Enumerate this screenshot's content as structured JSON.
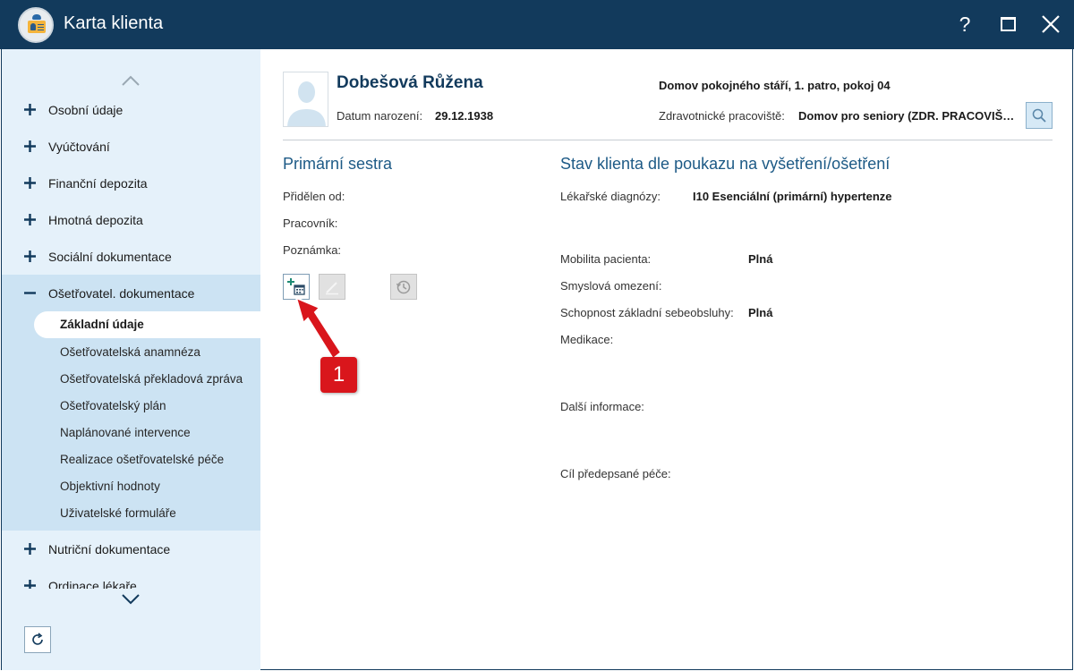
{
  "window": {
    "title": "Karta klienta",
    "help_label": "?",
    "icons": {
      "app": "client-card-icon",
      "maximize": "maximize-icon",
      "close": "close-icon"
    }
  },
  "sidebar": {
    "items_top": [
      {
        "label": "Osobní údaje",
        "expanded": false
      },
      {
        "label": "Vyúčtování",
        "expanded": false
      },
      {
        "label": "Finanční depozita",
        "expanded": false
      },
      {
        "label": "Hmotná depozita",
        "expanded": false
      },
      {
        "label": "Sociální dokumentace",
        "expanded": false
      },
      {
        "label": "Ošetřovatel. dokumentace",
        "expanded": true
      }
    ],
    "sub_items": [
      {
        "label": "Základní údaje",
        "active": true
      },
      {
        "label": "Ošetřovatelská anamnéza"
      },
      {
        "label": "Ošetřovatelská překladová zpráva"
      },
      {
        "label": "Ošetřovatelský plán"
      },
      {
        "label": "Naplánované intervence"
      },
      {
        "label": "Realizace ošetřovatelské péče"
      },
      {
        "label": "Objektivní hodnoty"
      },
      {
        "label": "Uživatelské formuláře"
      }
    ],
    "items_bottom": [
      {
        "label": "Nutriční dokumentace",
        "expanded": false
      },
      {
        "label": "Ordinace lékaře",
        "expanded": false
      }
    ]
  },
  "client": {
    "name": "Dobešová Růžena",
    "dob_label": "Datum narození:",
    "dob_value": "29.12.1938",
    "location": "Domov pokojného stáří, 1. patro, pokoj 04",
    "facility_label": "Zdravotnické pracoviště:",
    "facility_value": "Domov pro seniory (ZDR. PRACOVIŠTĚ)"
  },
  "primary_nurse": {
    "title": "Primární sestra",
    "assigned_label": "Přidělen od:",
    "worker_label": "Pracovník:",
    "note_label": "Poznámka:"
  },
  "status": {
    "title": "Stav klienta dle poukazu na vyšetření/ošetření",
    "diagnoses_label": "Lékařské diagnózy:",
    "diagnoses_value": "I10 Esenciální (primární) hypertenze",
    "mobility_label": "Mobilita pacienta:",
    "mobility_value": "Plná",
    "sensory_label": "Smyslová omezení:",
    "selfcare_label": "Schopnost základní sebeobsluhy:",
    "selfcare_value": "Plná",
    "medication_label": "Medikace:",
    "other_label": "Další informace:",
    "goal_label": "Cíl předepsané péče:"
  },
  "annotation": {
    "badge": "1",
    "color": "#d9161c"
  }
}
